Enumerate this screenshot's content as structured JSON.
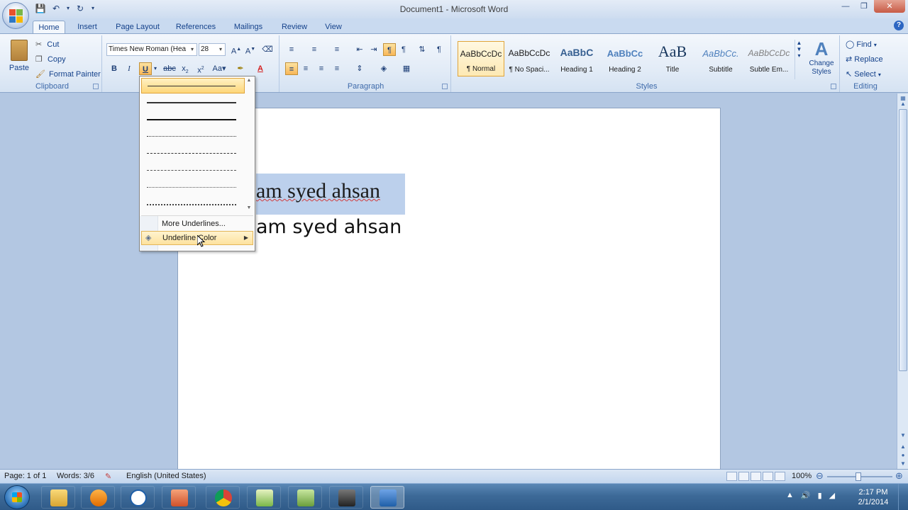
{
  "window": {
    "title": "Document1 - Microsoft Word"
  },
  "tabs": [
    "Home",
    "Insert",
    "Page Layout",
    "References",
    "Mailings",
    "Review",
    "View"
  ],
  "clipboard": {
    "paste": "Paste",
    "cut": "Cut",
    "copy": "Copy",
    "format_painter": "Format Painter",
    "label": "Clipboard"
  },
  "font": {
    "name": "Times New Roman (Hea",
    "size": "28"
  },
  "paragraph": {
    "label": "Paragraph"
  },
  "styles": {
    "items": [
      {
        "sample": "AaBbCcDc",
        "name": "¶ Normal"
      },
      {
        "sample": "AaBbCcDc",
        "name": "¶ No Spaci..."
      },
      {
        "sample": "AaBbC",
        "name": "Heading 1"
      },
      {
        "sample": "AaBbCc",
        "name": "Heading 2"
      },
      {
        "sample": "AaB",
        "name": "Title"
      },
      {
        "sample": "AaBbCc.",
        "name": "Subtitle"
      },
      {
        "sample": "AaBbCcDc",
        "name": "Subtle Em..."
      }
    ],
    "change_styles": "Change Styles",
    "label": "Styles"
  },
  "editing": {
    "find": "Find",
    "replace": "Replace",
    "select": "Select",
    "label": "Editing"
  },
  "document": {
    "line1": "am syed ahsan",
    "line2": "am syed ahsan"
  },
  "underline_menu": {
    "more": "More Underlines...",
    "color": "Underline Color"
  },
  "status": {
    "page": "Page: 1 of 1",
    "words": "Words: 3/6",
    "language": "English (United States)",
    "zoom": "100%"
  },
  "clock": {
    "time": "2:17 PM",
    "date": "2/1/2014"
  }
}
